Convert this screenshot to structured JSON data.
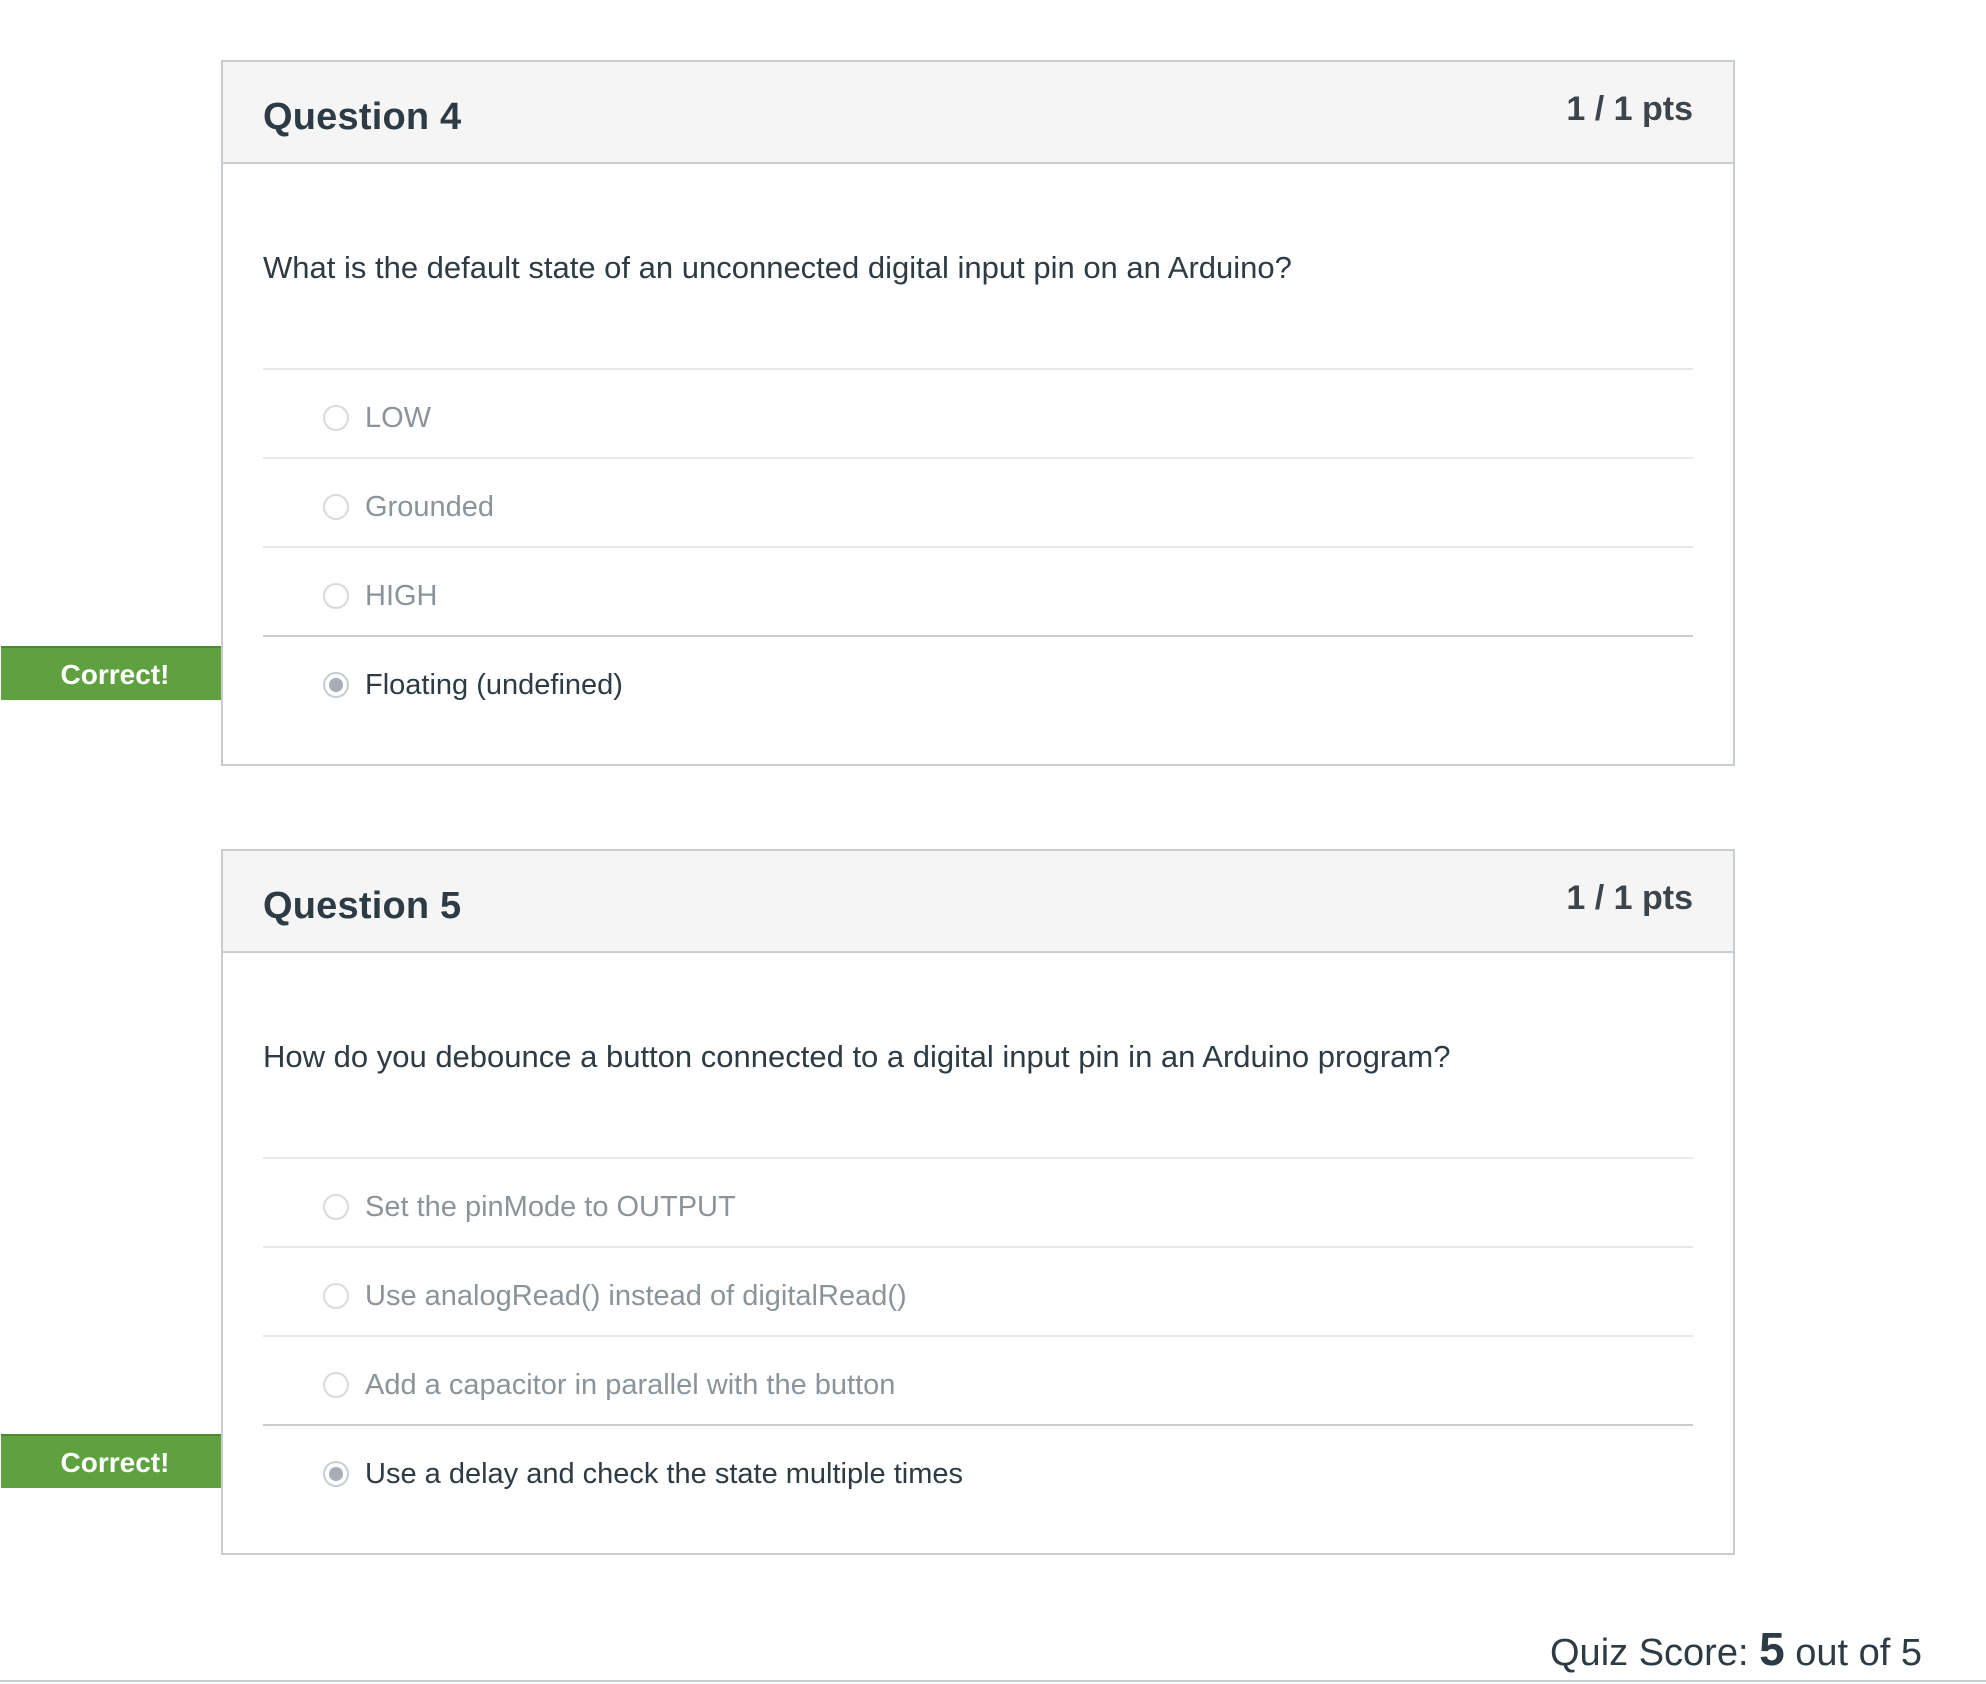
{
  "questions": [
    {
      "title": "Question 4",
      "points": "1 / 1 pts",
      "text": "What is the default state of an unconnected digital input pin on an Arduino?",
      "answers": [
        {
          "label": "LOW",
          "selected": false
        },
        {
          "label": "Grounded",
          "selected": false
        },
        {
          "label": "HIGH",
          "selected": false
        },
        {
          "label": "Floating (undefined)",
          "selected": true
        }
      ],
      "result": "Correct!"
    },
    {
      "title": "Question 5",
      "points": "1 / 1 pts",
      "text": "How do you debounce a button connected to a digital input pin in an Arduino program?",
      "answers": [
        {
          "label": "Set the pinMode to OUTPUT",
          "selected": false
        },
        {
          "label": "Use analogRead() instead of digitalRead()",
          "selected": false
        },
        {
          "label": "Add a capacitor in parallel with the button",
          "selected": false
        },
        {
          "label": "Use a delay and check the state multiple times",
          "selected": true
        }
      ],
      "result": "Correct!"
    }
  ],
  "quiz_score": {
    "prefix": "Quiz Score: ",
    "score": "5",
    "suffix": " out of 5"
  },
  "colors": {
    "correct_flag": "#5ea13e",
    "header_bg": "#f5f5f5",
    "border": "#c7cdd1"
  }
}
